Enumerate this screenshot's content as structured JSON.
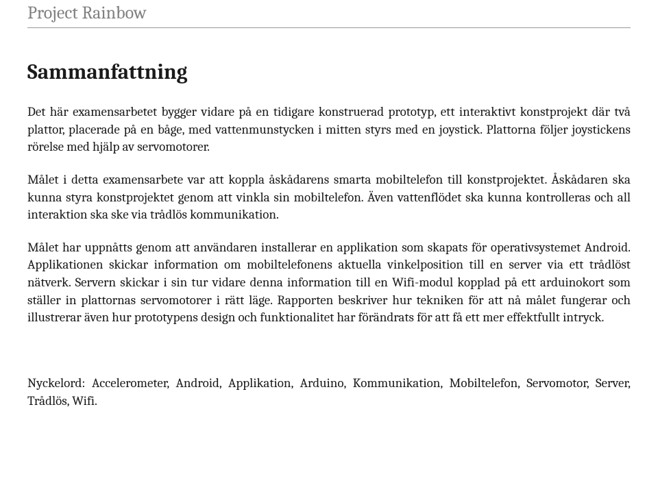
{
  "header": {
    "title": "Project Rainbow"
  },
  "section": {
    "heading": "Sammanfattning",
    "paragraphs": [
      "Det här examensarbetet bygger vidare på en tidigare konstruerad prototyp, ett interaktivt konstprojekt där två plattor, placerade på en båge, med vattenmunstycken i mitten styrs med en joystick. Plattorna följer joystickens rörelse med hjälp av servomotorer.",
      "Målet i detta examensarbete var att koppla åskådarens smarta mobiltelefon till konstprojektet. Åskådaren ska kunna styra konstprojektet genom att vinkla sin mobiltelefon. Även vattenflödet ska kunna kontrolleras och all interaktion ska ske via trådlös kommunikation.",
      "Målet har uppnåtts genom att användaren installerar en applikation som skapats för operativsystemet Android. Applikationen skickar information om mobiltelefonens aktuella vinkelposition till en server via ett trådlöst nätverk. Servern skickar i sin tur vidare denna information till en Wifi-modul kopplad på ett arduinokort som ställer in plattornas servomotorer i rätt läge. Rapporten beskriver hur tekniken för att nå målet fungerar och illustrerar även hur prototypens design och funktionalitet har förändrats för att få ett mer effektfullt intryck."
    ],
    "keywords": "Nyckelord: Accelerometer, Android, Applikation, Arduino, Kommunikation, Mobiltelefon, Servomotor, Server, Trådlös, Wifi."
  }
}
